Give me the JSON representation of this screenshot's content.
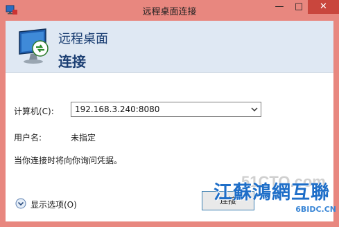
{
  "window": {
    "title": "远程桌面连接",
    "controls": {
      "minimize": "—",
      "maximize": "□",
      "close": "✕"
    }
  },
  "banner": {
    "line1": "远程桌面",
    "line2": "连接"
  },
  "form": {
    "computer_label": "计算机(C):",
    "computer_value": "192.168.3.240:8080",
    "user_label": "用户名:",
    "user_value": "未指定",
    "hint": "当你连接时将向你询问凭据。"
  },
  "footer": {
    "show_options": "显示选项(O)",
    "connect_button": "连接"
  },
  "watermark": {
    "site": "51CTO.com",
    "main": "江蘇鴻網互聯",
    "sub": "6BIDC.CN"
  }
}
